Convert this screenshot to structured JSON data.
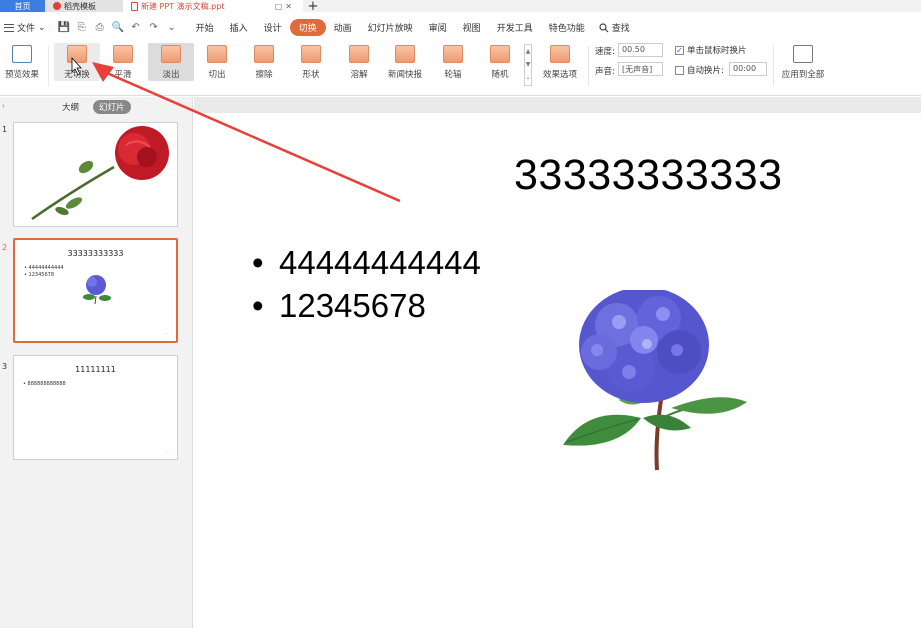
{
  "tabs": {
    "home": "首页",
    "docer": "稻壳模板",
    "document": "新建 PPT 演示文稿.ppt",
    "new_tab": "+"
  },
  "menu": {
    "file": "文件",
    "items": [
      "开始",
      "插入",
      "设计",
      "切换",
      "动画",
      "幻灯片放映",
      "审阅",
      "视图",
      "开发工具",
      "特色功能"
    ],
    "active": "切换",
    "search": "查找"
  },
  "ribbon": {
    "preview": "预览效果",
    "transitions": [
      "无切换",
      "平滑",
      "淡出",
      "切出",
      "擦除",
      "形状",
      "溶解",
      "新闻快报",
      "轮辐",
      "随机"
    ],
    "selected_transition": "淡出",
    "effect_options": "效果选项",
    "speed_label": "速度:",
    "speed_value": "00.50",
    "sound_label": "声音:",
    "sound_value": "[无声音]",
    "on_click_label": "单击鼠标时换片",
    "on_click_checked": true,
    "auto_label": "自动换片:",
    "auto_checked": false,
    "auto_value": "00:00",
    "apply_all": "应用到全部"
  },
  "panel": {
    "tab_outline": "大纲",
    "tab_slides": "幻灯片",
    "active_tab": "幻灯片"
  },
  "slides": [
    {
      "number": "1"
    },
    {
      "number": "2",
      "title": "33333333333",
      "bullets": [
        "44444444444",
        "12345678"
      ]
    },
    {
      "number": "3",
      "title": "11111111",
      "bullets": [
        "888888888888"
      ]
    }
  ],
  "current_slide": {
    "title": "33333333333",
    "bullets": [
      "44444444444",
      "12345678"
    ]
  },
  "colors": {
    "accent": "#e16a3b",
    "home_tab": "#3b7de0",
    "annotation_arrow": "#e8403a"
  }
}
